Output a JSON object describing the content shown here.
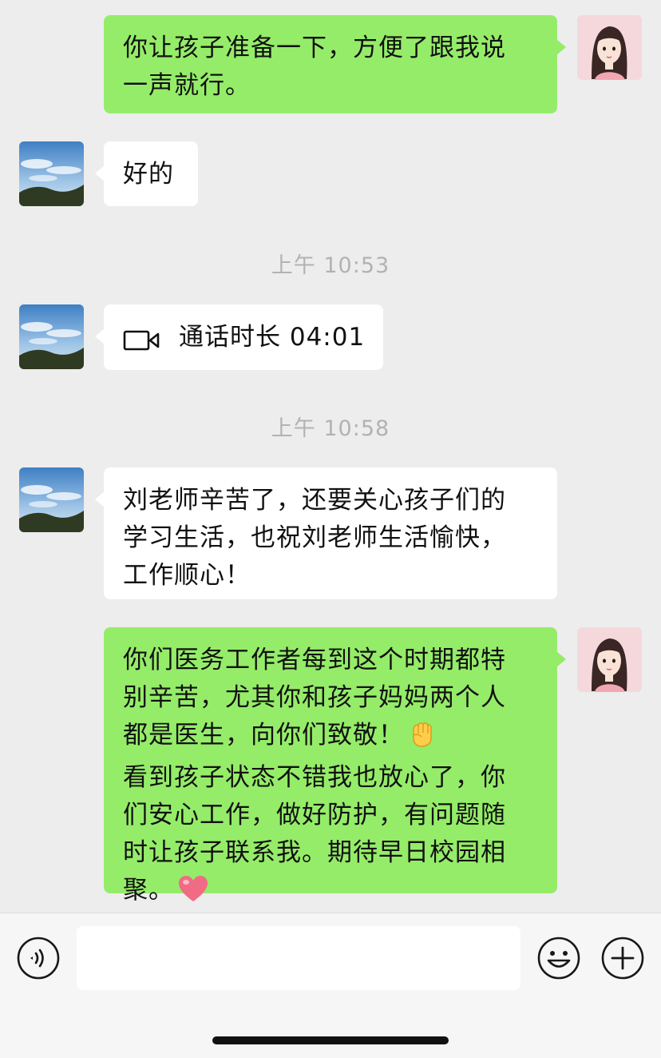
{
  "messages": [
    {
      "side": "sent",
      "lines": [
        "你让孩子准备一下，方便了跟我说",
        "一声就行。"
      ]
    },
    {
      "side": "received",
      "lines": [
        "好的"
      ]
    },
    {
      "type": "timestamp",
      "text": "上午 10:53"
    },
    {
      "side": "received",
      "type": "call",
      "icon": "video-call-icon",
      "text": "通话时长 04:01"
    },
    {
      "type": "timestamp",
      "text": "上午 10:58"
    },
    {
      "side": "received",
      "lines": [
        "刘老师辛苦了，还要关心孩子们的",
        "学习生活，也祝刘老师生活愉快，",
        "工作顺心！"
      ]
    },
    {
      "side": "sent",
      "lines": [
        "你们医务工作者每到这个时期都特",
        "别辛苦，尤其你和孩子妈妈两个人",
        "都是医生，向你们致敬！",
        "看到孩子状态不错我也放心了，你",
        "们安心工作，做好防护，有问题随",
        "时让孩子联系我。期待早日校园相",
        "聚。"
      ],
      "emojis": [
        "raised-fist-emoji",
        "heart-emoji"
      ]
    }
  ],
  "input_bar": {
    "voice_icon": "voice-input-icon",
    "text_value": "",
    "emoji_icon": "emoji-smile-icon",
    "plus_icon": "plus-circle-icon"
  },
  "colors": {
    "sent_bubble": "#95ec69",
    "received_bubble": "#ffffff",
    "background": "#ededed",
    "timestamp": "#b2b2b2"
  }
}
